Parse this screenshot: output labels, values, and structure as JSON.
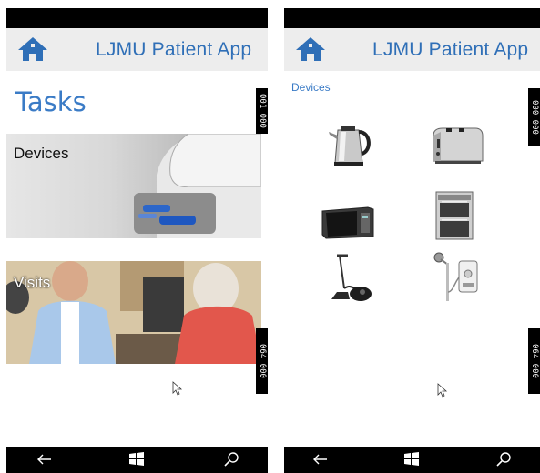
{
  "app": {
    "title": "LJMU Patient  App",
    "accent_color": "#2f6fb7"
  },
  "left_screen": {
    "page_title": "Tasks",
    "tiles": [
      {
        "label": "Devices",
        "icon": "device-appliance-photo"
      },
      {
        "label": "Visits",
        "icon": "doctor-visit-photo"
      }
    ],
    "markers": [
      "001 000",
      "064 000"
    ]
  },
  "right_screen": {
    "breadcrumb": "Devices",
    "devices": [
      {
        "name": "kettle-icon"
      },
      {
        "name": "toaster-icon"
      },
      {
        "name": "microwave-icon"
      },
      {
        "name": "oven-icon"
      },
      {
        "name": "vacuum-cleaner-icon"
      },
      {
        "name": "electric-shower-icon"
      }
    ],
    "markers": [
      "000 000",
      "064 000"
    ]
  },
  "nav": {
    "back": "back-arrow-icon",
    "windows": "windows-icon",
    "search": "search-icon"
  }
}
